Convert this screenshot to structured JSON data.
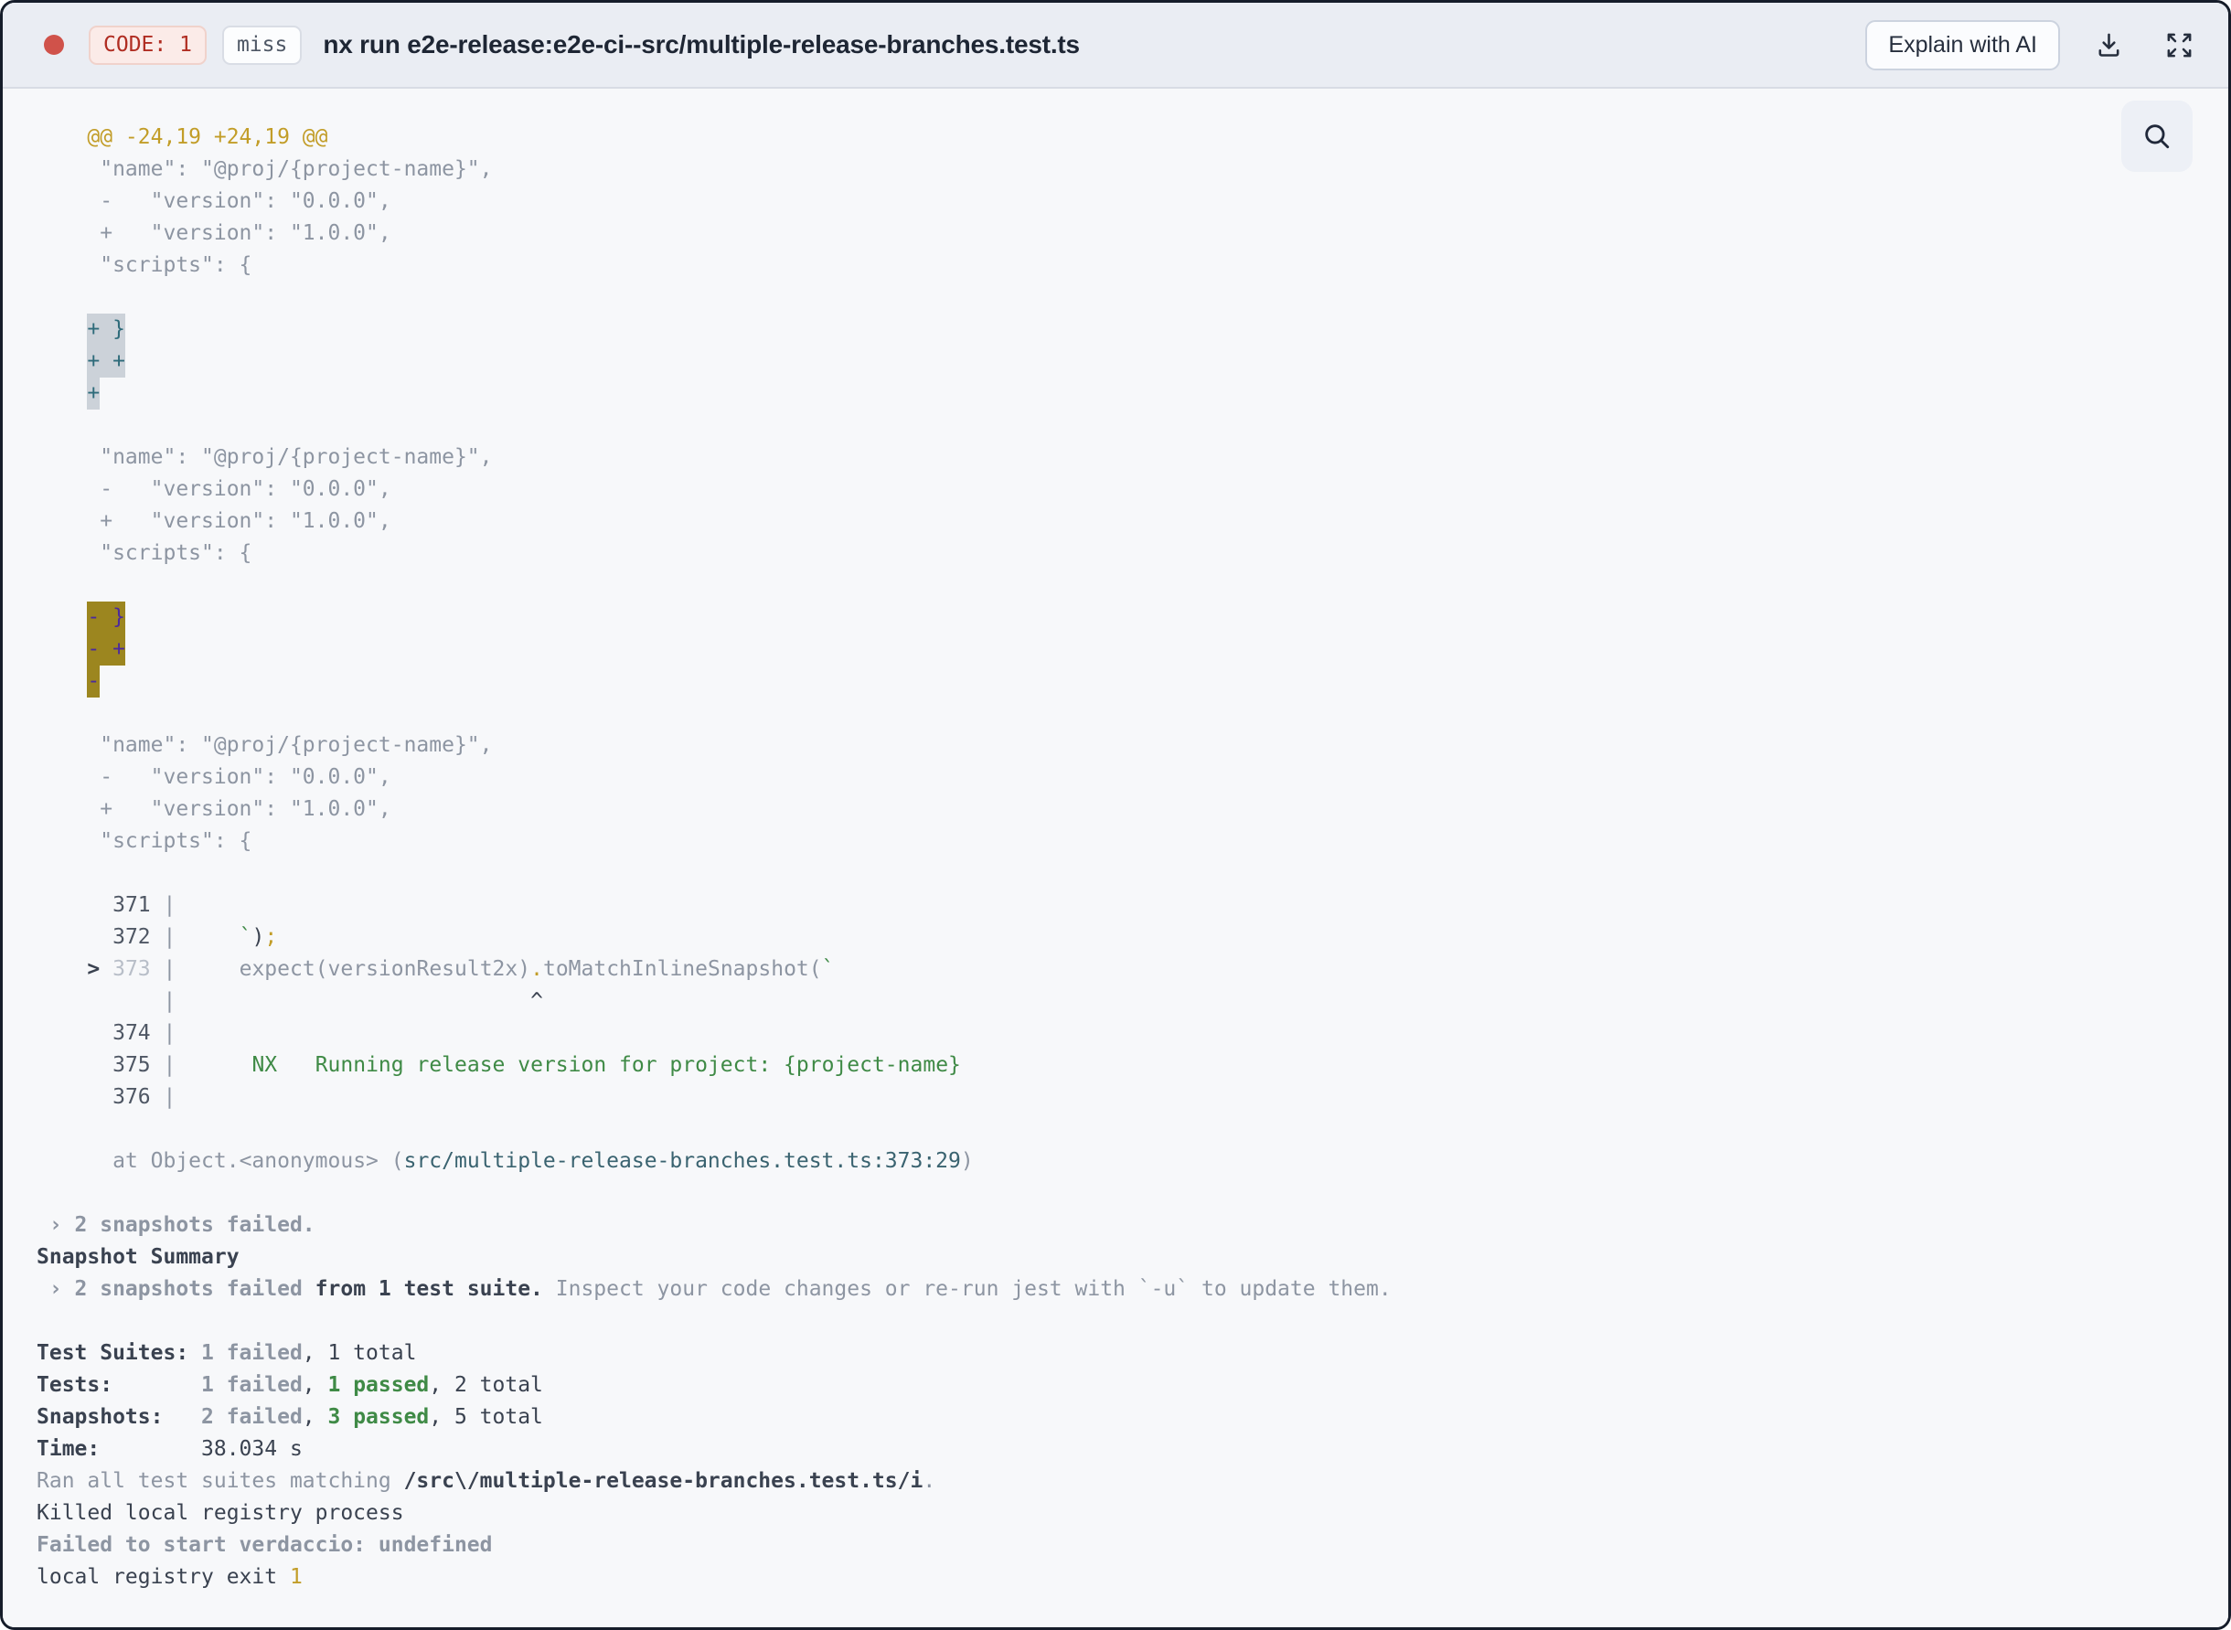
{
  "header": {
    "exit_code_badge": "CODE: 1",
    "cache_badge": "miss",
    "title": "nx run e2e-release:e2e-ci--src/multiple-release-branches.test.ts",
    "explain_button_label": "Explain with AI",
    "icons": {
      "status_dot": "record-dot-icon",
      "download": "download-icon",
      "expand": "expand-icon",
      "search": "search-icon"
    }
  },
  "colors": {
    "status_dot": "#d0524a",
    "exit_badge_text": "#b02d22",
    "diff_header_gold": "#c29d28",
    "code_frame_green": "#3f8a46",
    "selection_teal_text": "#2e6b7a",
    "selection_gray_bg": "#ccd2d9",
    "selection_purple_text": "#4b2a9e",
    "selection_olive_bg": "#9c861f",
    "stack_path_teal": "#3a6370"
  },
  "terminal": {
    "lines": [
      [
        {
          "t": "    ",
          "c": ""
        },
        {
          "t": "@@ -24,19 +24,19 @@",
          "c": "gold"
        }
      ],
      [
        {
          "t": "     \"name\": \"@proj/{project-name}\",",
          "c": "gray"
        }
      ],
      [
        {
          "t": "     -   \"version\": \"0.0.0\",",
          "c": "gray"
        }
      ],
      [
        {
          "t": "     +   \"version\": \"1.0.0\",",
          "c": "gray"
        }
      ],
      [
        {
          "t": "     \"scripts\": {",
          "c": "gray"
        }
      ],
      [],
      [
        {
          "t": "    ",
          "c": ""
        },
        {
          "t": "+ }",
          "c": "selg"
        }
      ],
      [
        {
          "t": "    ",
          "c": ""
        },
        {
          "t": "+ +",
          "c": "selg"
        }
      ],
      [
        {
          "t": "    ",
          "c": ""
        },
        {
          "t": "+",
          "c": "selg"
        }
      ],
      [],
      [
        {
          "t": "     \"name\": \"@proj/{project-name}\",",
          "c": "gray"
        }
      ],
      [
        {
          "t": "     -   \"version\": \"0.0.0\",",
          "c": "gray"
        }
      ],
      [
        {
          "t": "     +   \"version\": \"1.0.0\",",
          "c": "gray"
        }
      ],
      [
        {
          "t": "     \"scripts\": {",
          "c": "gray"
        }
      ],
      [],
      [
        {
          "t": "    ",
          "c": ""
        },
        {
          "t": "- }",
          "c": "sely"
        }
      ],
      [
        {
          "t": "    ",
          "c": ""
        },
        {
          "t": "- +",
          "c": "sely"
        }
      ],
      [
        {
          "t": "    ",
          "c": ""
        },
        {
          "t": "-",
          "c": "sely"
        }
      ],
      [],
      [
        {
          "t": "     \"name\": \"@proj/{project-name}\",",
          "c": "gray"
        }
      ],
      [
        {
          "t": "     -   \"version\": \"0.0.0\",",
          "c": "gray"
        }
      ],
      [
        {
          "t": "     +   \"version\": \"1.0.0\",",
          "c": "gray"
        }
      ],
      [
        {
          "t": "     \"scripts\": {",
          "c": "gray"
        }
      ],
      [],
      [
        {
          "t": "      ",
          "c": ""
        },
        {
          "t": "371",
          "c": "num"
        },
        {
          "t": " ",
          "c": ""
        },
        {
          "t": "|",
          "c": "gray"
        }
      ],
      [
        {
          "t": "      ",
          "c": ""
        },
        {
          "t": "372",
          "c": "num"
        },
        {
          "t": " ",
          "c": ""
        },
        {
          "t": "|",
          "c": "gray"
        },
        {
          "t": "     ",
          "c": ""
        },
        {
          "t": "`",
          "c": "green"
        },
        {
          "t": ")",
          "c": "dark"
        },
        {
          "t": ";",
          "c": "gold"
        }
      ],
      [
        {
          "t": "    ",
          "c": ""
        },
        {
          "t": "> ",
          "c": "dark b"
        },
        {
          "t": "373",
          "c": "numdim"
        },
        {
          "t": " ",
          "c": ""
        },
        {
          "t": "|",
          "c": "gray"
        },
        {
          "t": "     ",
          "c": ""
        },
        {
          "t": "expect(versionResult2x)",
          "c": "gray"
        },
        {
          "t": ".",
          "c": "gold"
        },
        {
          "t": "toMatchInlineSnapshot(",
          "c": "gray"
        },
        {
          "t": "`",
          "c": "green"
        }
      ],
      [
        {
          "t": "          ",
          "c": ""
        },
        {
          "t": "|",
          "c": "gray"
        },
        {
          "t": "                            ",
          "c": ""
        },
        {
          "t": "^",
          "c": "dark"
        }
      ],
      [
        {
          "t": "      ",
          "c": ""
        },
        {
          "t": "374",
          "c": "num"
        },
        {
          "t": " ",
          "c": ""
        },
        {
          "t": "|",
          "c": "gray"
        }
      ],
      [
        {
          "t": "      ",
          "c": ""
        },
        {
          "t": "375",
          "c": "num"
        },
        {
          "t": " ",
          "c": ""
        },
        {
          "t": "|",
          "c": "gray"
        },
        {
          "t": "      ",
          "c": ""
        },
        {
          "t": "NX   Running release version for project: {project-name}",
          "c": "green"
        }
      ],
      [
        {
          "t": "      ",
          "c": ""
        },
        {
          "t": "376",
          "c": "num"
        },
        {
          "t": " ",
          "c": ""
        },
        {
          "t": "|",
          "c": "gray"
        }
      ],
      [],
      [
        {
          "t": "      ",
          "c": ""
        },
        {
          "t": "at Object.<anonymous> (",
          "c": "gray"
        },
        {
          "t": "src/multiple-release-branches.test.ts:373:29",
          "c": "path"
        },
        {
          "t": ")",
          "c": "gray"
        }
      ],
      [],
      [
        {
          "t": " › ",
          "c": "gray b"
        },
        {
          "t": "2 snapshots failed.",
          "c": "gray b"
        }
      ],
      [
        {
          "t": "Snapshot Summary",
          "c": "dark b"
        }
      ],
      [
        {
          "t": " › ",
          "c": "gray b"
        },
        {
          "t": "2 snapshots failed",
          "c": "gray b"
        },
        {
          "t": " ",
          "c": ""
        },
        {
          "t": "from 1 test suite.",
          "c": "dark b"
        },
        {
          "t": " ",
          "c": ""
        },
        {
          "t": "Inspect your code changes or re-run jest with `-u` to update them.",
          "c": "gray"
        }
      ],
      [],
      [
        {
          "t": "Test Suites: ",
          "c": "dark b"
        },
        {
          "t": "1 failed",
          "c": "gray b"
        },
        {
          "t": ", 1 total",
          "c": "dark"
        }
      ],
      [
        {
          "t": "Tests:       ",
          "c": "dark b"
        },
        {
          "t": "1 failed",
          "c": "gray b"
        },
        {
          "t": ", ",
          "c": "dark"
        },
        {
          "t": "1 passed",
          "c": "green b"
        },
        {
          "t": ", 2 total",
          "c": "dark"
        }
      ],
      [
        {
          "t": "Snapshots:   ",
          "c": "dark b"
        },
        {
          "t": "2 failed",
          "c": "gray b"
        },
        {
          "t": ", ",
          "c": "dark"
        },
        {
          "t": "3 passed",
          "c": "green b"
        },
        {
          "t": ", 5 total",
          "c": "dark"
        }
      ],
      [
        {
          "t": "Time:        ",
          "c": "dark b"
        },
        {
          "t": "38.034 s",
          "c": "dark"
        }
      ],
      [
        {
          "t": "Ran all test suites matching ",
          "c": "gray"
        },
        {
          "t": "/src\\/multiple-release-branches.test.ts/i",
          "c": "dark b"
        },
        {
          "t": ".",
          "c": "gray"
        }
      ],
      [
        {
          "t": "Killed local registry process",
          "c": "dark"
        }
      ],
      [
        {
          "t": "Failed to start verdaccio: undefined",
          "c": "gray b"
        }
      ],
      [
        {
          "t": "local registry exit ",
          "c": "dark"
        },
        {
          "t": "1",
          "c": "gold"
        }
      ]
    ]
  }
}
